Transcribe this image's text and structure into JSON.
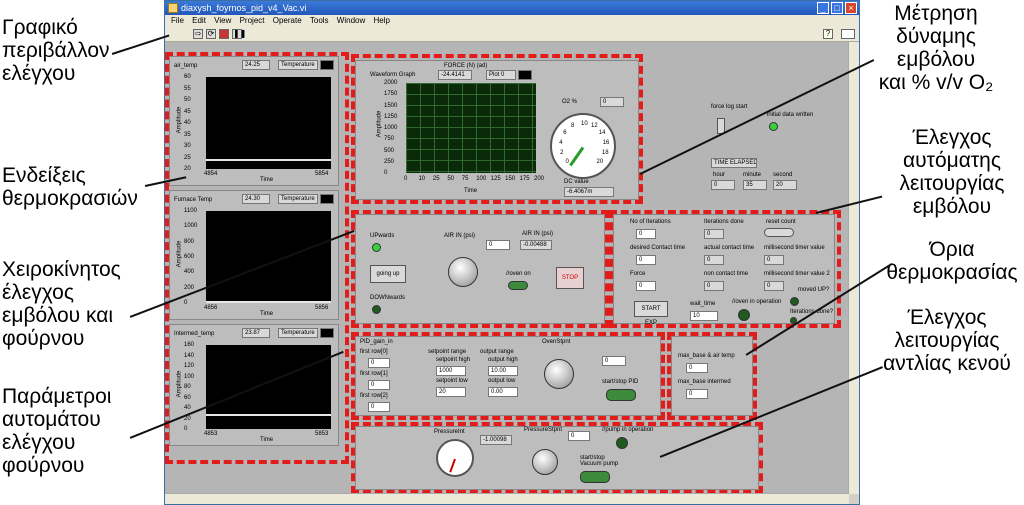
{
  "annotations": {
    "gui": [
      "Γραφικό",
      "περιβάλλον",
      "ελέγχου"
    ],
    "temp_indicators": [
      "Ενδείξεις",
      "θερμοκρασιών"
    ],
    "manual_control": [
      "Χειροκίνητος",
      "έλεγχος",
      "εμβόλου και",
      "φούρνου"
    ],
    "auto_params": [
      "Παράμετροι",
      "αυτομάτου",
      "ελέγχου",
      "φούρνου"
    ],
    "force_measure": [
      "Μέτρηση",
      "δύναμης",
      "εμβόλου",
      "και %  v/v O₂"
    ],
    "auto_piston": [
      "Έλεγχος",
      "αυτόματης",
      "λειτουργίας",
      "εμβόλου"
    ],
    "temp_limits": [
      "Όρια",
      "θερμοκρασίας"
    ],
    "vacuum": [
      "Έλεγχος",
      "λειτουργίας",
      "αντλίας κενού"
    ]
  },
  "window": {
    "title": "diaxysh_foyrnos_pid_v4_Vac.vi",
    "menu": [
      "File",
      "Edit",
      "View",
      "Project",
      "Operate",
      "Tools",
      "Window",
      "Help"
    ]
  },
  "temps": [
    {
      "name": "air_temp",
      "value": "24.25",
      "legend": "Temperature",
      "ylabel": "Amplitude",
      "xlabel": "Time",
      "xmin": "4854",
      "xmax": "5854",
      "yticks": [
        "60",
        "55",
        "50",
        "45",
        "40",
        "35",
        "30",
        "25",
        "20"
      ],
      "trace": 0.09
    },
    {
      "name": "Furnace Temp",
      "value": "24.30",
      "legend": "Temperature",
      "ylabel": "Amplitude",
      "xlabel": "Time",
      "xmin": "4856",
      "xmax": "5856",
      "yticks": [
        "1100",
        "1000",
        "800",
        "600",
        "400",
        "200",
        "0"
      ],
      "trace": 0.0
    },
    {
      "name": "Intermed_temp",
      "value": "23.87",
      "legend": "Temperature",
      "ylabel": "Amplitude",
      "xlabel": "Time",
      "xmin": "4853",
      "xmax": "5853",
      "yticks": [
        "160",
        "140",
        "120",
        "100",
        "80",
        "60",
        "40",
        "20",
        "0"
      ],
      "trace": 0.15
    }
  ],
  "force": {
    "header": "FORCE (N) (ad)",
    "value": "-24.4141",
    "plot_legend": "Plot 0",
    "graph_title": "Waveform Graph",
    "ylabel": "Amplitude",
    "xlabel": "Time",
    "yticks": [
      "2000",
      "1750",
      "1500",
      "1250",
      "1000",
      "750",
      "500",
      "250",
      "0"
    ],
    "xticks": [
      "0",
      "10",
      "25",
      "50",
      "75",
      "100",
      "125",
      "150",
      "175",
      "200"
    ],
    "o2_label": "O2 %",
    "o2_value": "0",
    "dial_ticks": [
      "0",
      "2",
      "4",
      "6",
      "8",
      "10",
      "12",
      "14",
      "16",
      "18",
      "20"
    ],
    "dc_label": "DC value",
    "dc_value": "-6.4067m"
  },
  "manual": {
    "up_label": "UPwards",
    "down_label": "DOWNwards",
    "going_up": "going up",
    "air_in_label": "AIR IN (psi)",
    "air_in_value": "0",
    "air_in_knob_ticks": [
      "0",
      "1",
      "2",
      "3",
      "4",
      "5",
      "6"
    ],
    "air_in2_label": "AIR IN (psi)",
    "air_in2_value": "-0.00488",
    "oven_on_label": "//oven on",
    "stop_label": "STOP"
  },
  "auto_piston": {
    "no_iter_label": "No of Iterations",
    "no_iter_value": "0",
    "iter_done_label": "Iterations done",
    "iter_done_value": "0",
    "reset_count": "reset count",
    "contact_label": "desired Contact time",
    "contact_value": "0",
    "actual_label": "actual contact time",
    "actual_value": "0",
    "ms_label": "millisecond timer value",
    "ms_value": "0",
    "force_label": "Force",
    "force_value": "0",
    "noncontact_label": "non contact time",
    "noncontact_value": "0",
    "ms2_label": "millisecond timer value 2",
    "ms2_value": "0",
    "start_exp": "START EXP",
    "wait_label": "wait_time",
    "wait_value": "10",
    "oven_op_label": "//oven in operation",
    "moved_up": "moved UP?",
    "iter_done_q": "Iterations done?"
  },
  "elapsed": {
    "force_log": "force log start",
    "initial_data": "initial data written",
    "title": "TIME ELAPSED",
    "hour_label": "hour",
    "hour": "0",
    "minute_label": "minute",
    "minute": "35",
    "second_label": "second",
    "second": "20"
  },
  "pid": {
    "gain_label": "PID_gain_in",
    "rows": [
      "first row[0]",
      "first row[1]",
      "first row[2]"
    ],
    "row_values": [
      "0",
      "0",
      "0"
    ],
    "setpoint_range": "setpoint range",
    "sp_high_label": "setpoint high",
    "sp_high": "1000",
    "sp_low_label": "setpoint low",
    "sp_low": "20",
    "output_range": "output range",
    "out_high_label": "output high",
    "out_high": "10.00",
    "out_low_label": "output low",
    "out_low": "0.00",
    "oven_stpnt": "OvenStpnt",
    "knob_ticks": [
      "200",
      "400",
      "600",
      "800",
      "1000",
      "20"
    ],
    "stpnt_value": "0",
    "start_stop": "start/stop PID"
  },
  "limits": {
    "max_base_air": "max_base & air temp",
    "max_base_air_value": "0",
    "max_base_int": "max_base intermed",
    "max_base_int_value": "0"
  },
  "vacuum": {
    "pressure_label": "PressureInt",
    "pressure_value": "-1.00098",
    "gauge_ticks": [
      "-0.5",
      "-1",
      "0"
    ],
    "stpnt_label": "PressureStpnt",
    "stpnt_value": "0",
    "knob_ticks": [
      "-0.6",
      "-0.4",
      "-0.8",
      "-0.2",
      "-1",
      "0"
    ],
    "pump_label": "//pump in operation",
    "start_stop": "start/stop Vacuum pump"
  }
}
